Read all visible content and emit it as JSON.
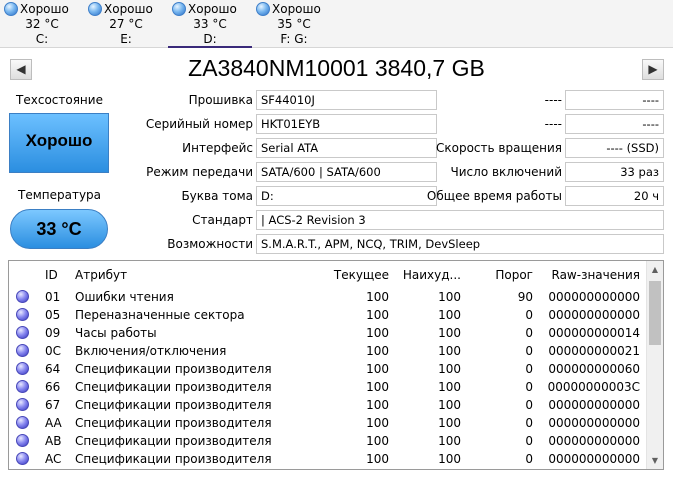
{
  "disks": [
    {
      "status": "Хорошо",
      "temp": "32 °C",
      "letter": "C:"
    },
    {
      "status": "Хорошо",
      "temp": "27 °C",
      "letter": "E:"
    },
    {
      "status": "Хорошо",
      "temp": "33 °C",
      "letter": "D:"
    },
    {
      "status": "Хорошо",
      "temp": "35 °C",
      "letter": "F: G:"
    }
  ],
  "title": "ZA3840NM10001 3840,7 GB",
  "nav": {
    "prev": "◀",
    "next": "▶"
  },
  "health": {
    "label": "Техсостояние",
    "value": "Хорошо"
  },
  "temperature": {
    "label": "Температура",
    "value": "33 °C"
  },
  "info": {
    "firmware": {
      "label": "Прошивка",
      "value": "SF44010J"
    },
    "serial": {
      "label": "Серийный номер",
      "value": "HKT01EYB"
    },
    "interface": {
      "label": "Интерфейс",
      "value": "Serial ATA"
    },
    "transfer": {
      "label": "Режим передачи",
      "value": "SATA/600 | SATA/600"
    },
    "volume": {
      "label": "Буква тома",
      "value": "D:"
    },
    "standard": {
      "label": "Стандарт",
      "value": "| ACS-2 Revision 3"
    },
    "features": {
      "label": "Возможности",
      "value": "S.M.A.R.T., APM, NCQ, TRIM, DevSleep"
    },
    "right1": {
      "label": "----",
      "value": "----"
    },
    "right2": {
      "label": "----",
      "value": "----"
    },
    "rotation": {
      "label": "Скорость вращения",
      "value": "---- (SSD)"
    },
    "power_count": {
      "label": "Число включений",
      "value": "33 раз"
    },
    "power_hours": {
      "label": "Общее время работы",
      "value": "20 ч"
    }
  },
  "table": {
    "headers": {
      "id": "ID",
      "attr": "Атрибут",
      "current": "Текущее",
      "worst": "Наихуд...",
      "threshold": "Порог",
      "raw": "Raw-значения"
    },
    "rows": [
      {
        "id": "01",
        "attr": "Ошибки чтения",
        "current": "100",
        "worst": "100",
        "threshold": "90",
        "raw": "000000000000"
      },
      {
        "id": "05",
        "attr": "Переназначенные сектора",
        "current": "100",
        "worst": "100",
        "threshold": "0",
        "raw": "000000000000"
      },
      {
        "id": "09",
        "attr": "Часы работы",
        "current": "100",
        "worst": "100",
        "threshold": "0",
        "raw": "000000000014"
      },
      {
        "id": "0C",
        "attr": "Включения/отключения",
        "current": "100",
        "worst": "100",
        "threshold": "0",
        "raw": "000000000021"
      },
      {
        "id": "64",
        "attr": "Спецификации производителя",
        "current": "100",
        "worst": "100",
        "threshold": "0",
        "raw": "000000000060"
      },
      {
        "id": "66",
        "attr": "Спецификации производителя",
        "current": "100",
        "worst": "100",
        "threshold": "0",
        "raw": "00000000003C"
      },
      {
        "id": "67",
        "attr": "Спецификации производителя",
        "current": "100",
        "worst": "100",
        "threshold": "0",
        "raw": "000000000000"
      },
      {
        "id": "AA",
        "attr": "Спецификации производителя",
        "current": "100",
        "worst": "100",
        "threshold": "0",
        "raw": "000000000000"
      },
      {
        "id": "AB",
        "attr": "Спецификации производителя",
        "current": "100",
        "worst": "100",
        "threshold": "0",
        "raw": "000000000000"
      },
      {
        "id": "AC",
        "attr": "Спецификации производителя",
        "current": "100",
        "worst": "100",
        "threshold": "0",
        "raw": "000000000000"
      }
    ]
  },
  "colors": {
    "health_blue": "#2b8ee0",
    "status_dot": "#3434c0",
    "active_tab": "#3a2a7a"
  }
}
